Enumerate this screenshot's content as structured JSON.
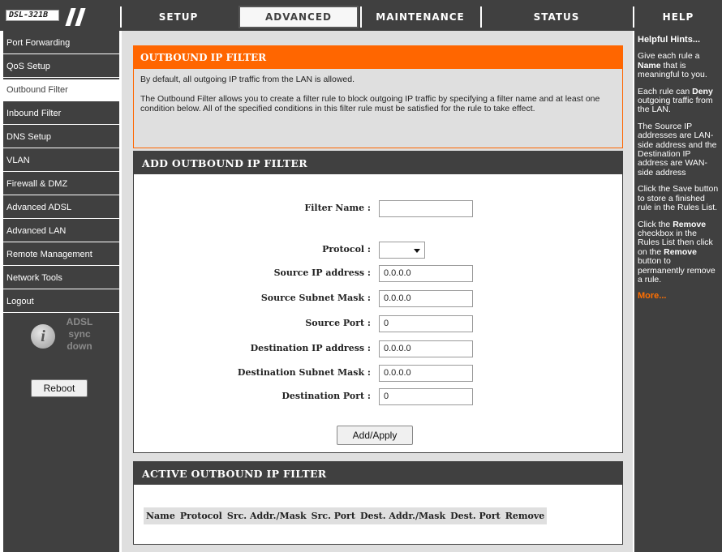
{
  "logo": {
    "model": "DSL-321B"
  },
  "top_tabs": [
    {
      "label": "SETUP"
    },
    {
      "label": "ADVANCED"
    },
    {
      "label": "MAINTENANCE"
    },
    {
      "label": "STATUS"
    },
    {
      "label": "HELP"
    }
  ],
  "active_tab": "ADVANCED",
  "sidebar": {
    "items": [
      {
        "label": "Port Forwarding"
      },
      {
        "label": "QoS Setup"
      },
      {
        "label": "Outbound Filter"
      },
      {
        "label": "Inbound Filter"
      },
      {
        "label": "DNS Setup"
      },
      {
        "label": "VLAN"
      },
      {
        "label": "Firewall & DMZ"
      },
      {
        "label": "Advanced ADSL"
      },
      {
        "label": "Advanced LAN"
      },
      {
        "label": "Remote Management"
      },
      {
        "label": "Network Tools"
      },
      {
        "label": "Logout"
      }
    ],
    "active_item": "Outbound Filter",
    "adsl_status": {
      "line1": "ADSL",
      "line2": "sync",
      "line3": "down",
      "icon": "info-icon"
    },
    "reboot_label": "Reboot"
  },
  "intro": {
    "title": "OUTBOUND IP FILTER",
    "para1": "By default, all outgoing IP traffic from the LAN is allowed.",
    "para2": "The Outbound Filter allows you to create a filter rule to block outgoing IP traffic by specifying a filter name and at least one condition below. All of the specified conditions in this filter rule must be satisfied for the rule to take effect."
  },
  "add_filter": {
    "title": "ADD OUTBOUND IP FILTER",
    "fields": {
      "filter_name": {
        "label": "Filter Name :",
        "value": ""
      },
      "protocol": {
        "label": "Protocol :",
        "value": ""
      },
      "source_ip": {
        "label": "Source IP address :",
        "value": "0.0.0.0"
      },
      "source_mask": {
        "label": "Source Subnet Mask :",
        "value": "0.0.0.0"
      },
      "source_port": {
        "label": "Source Port :",
        "value": "0"
      },
      "dest_ip": {
        "label": "Destination IP address :",
        "value": "0.0.0.0"
      },
      "dest_mask": {
        "label": "Destination Subnet Mask :",
        "value": "0.0.0.0"
      },
      "dest_port": {
        "label": "Destination Port :",
        "value": "0"
      }
    },
    "apply_label": "Add/Apply"
  },
  "active_filter": {
    "title": "ACTIVE OUTBOUND IP FILTER",
    "columns": [
      "Name",
      "Protocol",
      "Src. Addr./Mask",
      "Src. Port",
      "Dest. Addr./Mask",
      "Dest. Port",
      "Remove"
    ]
  },
  "hints": {
    "title": "Helpful Hints...",
    "hint1_pre": "Give each rule a ",
    "hint1_bold": "Name",
    "hint1_post": " that is meaningful to you.",
    "hint2_pre": "Each rule can ",
    "hint2_bold": "Deny",
    "hint2_post": " outgoing traffic from the LAN.",
    "hint3": "The Source IP addresses are LAN-side address and the Destination IP address are WAN-side address",
    "hint4": "Click the Save button to store a finished rule in the Rules List.",
    "hint5_pre": "Click the ",
    "hint5_bold1": "Remove",
    "hint5_mid": " checkbox in the Rules List then click on the ",
    "hint5_bold2": "Remove",
    "hint5_post": " button to permanently remove a rule.",
    "more": "More..."
  },
  "colors": {
    "dark_gray": "#404040",
    "accent_orange": "#ff6600",
    "content_bg": "#dfdfdf",
    "more_link": "#ff6f00"
  }
}
